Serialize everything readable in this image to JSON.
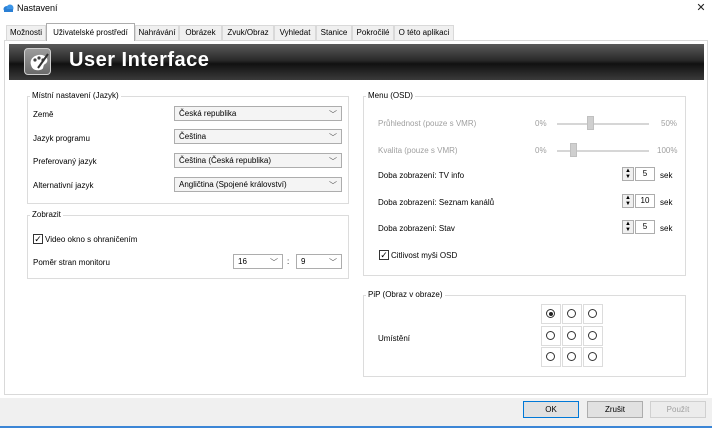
{
  "window": {
    "title": "Nastavení",
    "close_glyph": "✕"
  },
  "tabs": [
    "Možnosti",
    "Uživatelské prostředí",
    "Nahrávání",
    "Obrázek",
    "Zvuk/Obraz",
    "Vyhledat",
    "Stanice",
    "Pokročilé",
    "O této aplikaci"
  ],
  "active_tab": "Uživatelské prostředí",
  "banner": {
    "title": "User Interface",
    "icon": "palette-icon"
  },
  "language_group": {
    "title": "Místní nastavení (Jazyk)",
    "rows": [
      {
        "label": "Země",
        "value": "Česká republika"
      },
      {
        "label": "Jazyk programu",
        "value": "Čeština"
      },
      {
        "label": "Preferovaný jazyk",
        "value": "Čeština (Česká republika)"
      },
      {
        "label": "Alternativní jazyk",
        "value": "Angličtina (Spojené království)"
      }
    ]
  },
  "display_group": {
    "title": "Zobrazit",
    "video_checkbox": {
      "label": "Video okno s ohraničením",
      "checked": true,
      "mark": "✓"
    },
    "aspect": {
      "label": "Poměr stran monitoru",
      "left": "16",
      "separator": ":",
      "right": "9"
    }
  },
  "osd_group": {
    "title": "Menu (OSD)",
    "transparency": {
      "label": "Průhlednost (pouze s VMR)",
      "min": "0%",
      "max": "50%",
      "level": 0.35
    },
    "quality": {
      "label": "Kvalita (pouze s VMR)",
      "min": "0%",
      "max": "100%",
      "level": 0.15
    },
    "durations": [
      {
        "label": "Doba zobrazení: TV info",
        "value": "5",
        "unit": "sek"
      },
      {
        "label": "Doba zobrazení: Seznam kanálů",
        "value": "10",
        "unit": "sek"
      },
      {
        "label": "Doba zobrazení: Stav",
        "value": "5",
        "unit": "sek"
      }
    ],
    "mouse_checkbox": {
      "label": "Citlivost myši OSD",
      "checked": true,
      "mark": "✓"
    }
  },
  "pip_group": {
    "title": "PiP (Obraz v obraze)",
    "position_label": "Umístění",
    "selected": "top-left"
  },
  "buttons": {
    "ok": "OK",
    "cancel": "Zrušit",
    "apply": "Použít"
  },
  "glyphs": {
    "chevron": "﹀",
    "spin_up": "▲",
    "spin_down": "▼"
  }
}
